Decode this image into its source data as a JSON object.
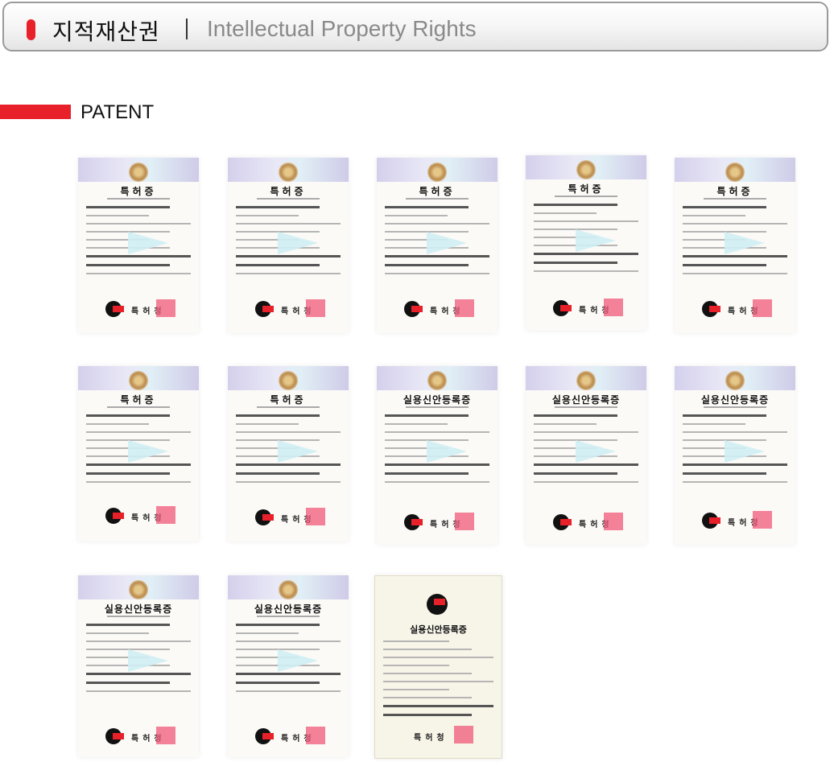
{
  "header": {
    "title_ko": "지적재산권",
    "title_en": "Intellectual Property Rights"
  },
  "section": {
    "label": "PATENT"
  },
  "colors": {
    "accent": "#e8202a",
    "title_en": "#8a8a8a"
  },
  "certificates": [
    {
      "title": "특허증",
      "office": "특허청"
    },
    {
      "title": "특허증",
      "office": "특허청"
    },
    {
      "title": "특허증",
      "office": "특허청"
    },
    {
      "title": "특허증",
      "office": "특허청"
    },
    {
      "title": "특허증",
      "office": "특허청"
    },
    {
      "title": "특허증",
      "office": "특허청"
    },
    {
      "title": "특허증",
      "office": "특허청"
    },
    {
      "title": "실용신안등록증",
      "office": "특허청"
    },
    {
      "title": "실용신안등록증",
      "office": "특허청"
    },
    {
      "title": "실용신안등록증",
      "office": "특허청"
    },
    {
      "title": "실용신안등록증",
      "office": "특허청"
    },
    {
      "title": "실용신안등록증",
      "office": "특허청"
    },
    {
      "title": "실용신안등록증",
      "office": "특허청"
    }
  ]
}
